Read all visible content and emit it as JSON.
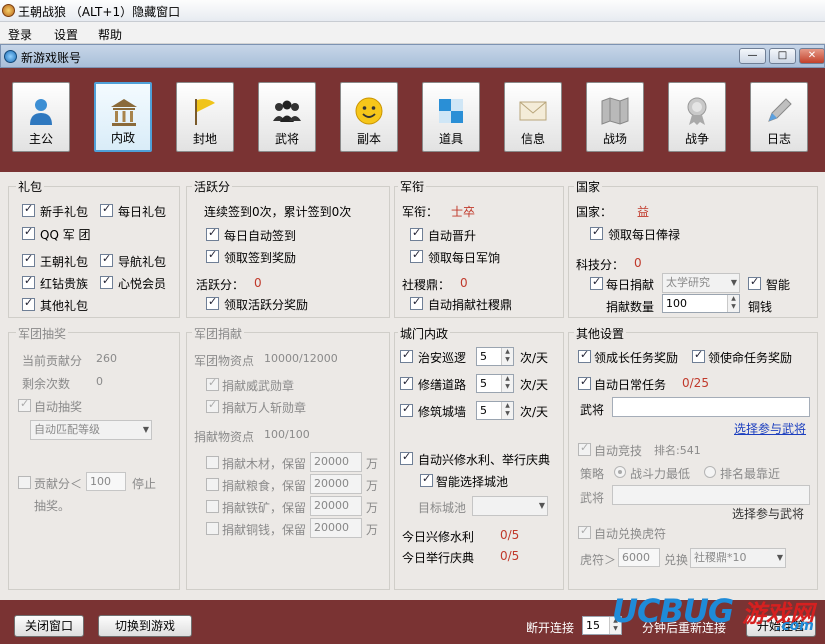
{
  "window": {
    "title": "王朝战狼 （ALT+1）隐藏窗口"
  },
  "menu": [
    "登录",
    "设置",
    "帮助"
  ],
  "subwindow": {
    "title": "新游戏账号",
    "buttons": [
      "—",
      "□",
      "✕"
    ]
  },
  "nav": [
    {
      "label": "主公",
      "icon": "person-icon"
    },
    {
      "label": "内政",
      "icon": "building-icon"
    },
    {
      "label": "封地",
      "icon": "flag-icon"
    },
    {
      "label": "武将",
      "icon": "group-icon"
    },
    {
      "label": "副本",
      "icon": "smiley-icon"
    },
    {
      "label": "道具",
      "icon": "tiles-icon"
    },
    {
      "label": "信息",
      "icon": "envelope-icon"
    },
    {
      "label": "战场",
      "icon": "map-icon"
    },
    {
      "label": "战争",
      "icon": "medal-icon"
    },
    {
      "label": "日志",
      "icon": "pencil-icon"
    }
  ],
  "libao": {
    "title": "礼包",
    "items": [
      "新手礼包",
      "每日礼包",
      "QQ 军 团",
      "王朝礼包",
      "导航礼包",
      "红钻贵族",
      "心悦会员",
      "其他礼包"
    ]
  },
  "huoyue": {
    "title": "活跃分",
    "sign_text": "连续签到0次，累计签到0次",
    "auto_sign": "每日自动签到",
    "sign_reward": "领取签到奖励",
    "score_label": "活跃分：",
    "score_value": "0",
    "score_reward": "领取活跃分奖励"
  },
  "junxian": {
    "title": "军衔",
    "rank_label": "军衔：",
    "rank_value": "士卒",
    "auto_promote": "自动晋升",
    "daily_pay": "领取每日军饷",
    "sheji_label": "社稷鼎：",
    "sheji_value": "0",
    "auto_donate": "自动捐献社稷鼎"
  },
  "guojia": {
    "title": "国家",
    "country_label": "国家：",
    "country_value": "益",
    "daily_salary": "领取每日俸禄",
    "tech_label": "科技分：",
    "tech_value": "0",
    "daily_donate": "每日捐献",
    "research": "太学研究",
    "smart": "智能",
    "qty_label": "捐献数量",
    "qty_value": "100",
    "unit": "铜钱"
  },
  "juntuan_choujiang": {
    "title": "军团抽奖",
    "contrib_label": "当前贡献分",
    "contrib_value": "260",
    "remain_label": "剩余次数",
    "remain_value": "0",
    "auto_draw": "自动抽奖",
    "level": "自动匹配等级",
    "contrib_prefix": "贡献分＜",
    "contrib_threshold": "100",
    "stop_text": "停止",
    "stop_text2": "抽奖。"
  },
  "juntuan_juanxian": {
    "title": "军团捐献",
    "goods_label": "军团物资点",
    "goods_value": "10000/12000",
    "medal1": "捐献威武勋章",
    "medal2": "捐献万人斩勋章",
    "goods2_label": "捐献物资点",
    "goods2_value": "100/100",
    "rows": [
      {
        "label": "捐献木材，保留",
        "value": "20000",
        "unit": "万"
      },
      {
        "label": "捐献粮食，保留",
        "value": "20000",
        "unit": "万"
      },
      {
        "label": "捐献铁矿，保留",
        "value": "20000",
        "unit": "万"
      },
      {
        "label": "捐献铜钱，保留",
        "value": "20000",
        "unit": "万"
      }
    ]
  },
  "chengmen": {
    "title": "城门内政",
    "rows": [
      {
        "label": "治安巡逻",
        "value": "5",
        "unit": "次/天"
      },
      {
        "label": "修缮道路",
        "value": "5",
        "unit": "次/天"
      },
      {
        "label": "修筑城墙",
        "value": "5",
        "unit": "次/天"
      }
    ],
    "auto_water": "自动兴修水利、举行庆典",
    "smart_city": "智能选择城池",
    "target_label": "目标城池",
    "today_water_label": "今日兴修水利",
    "today_water_value": "0/5",
    "today_fest_label": "今日举行庆典",
    "today_fest_value": "0/5"
  },
  "qita": {
    "title": "其他设置",
    "growth": "领成长任务奖励",
    "mission": "领使命任务奖励",
    "auto_daily": "自动日常任务",
    "daily_value": "0/25",
    "general_label": "武将",
    "choose_link": "选择参与武将",
    "auto_arena": "自动竞技",
    "rank_text": "排名:541",
    "strategy_label": "策略",
    "opt1": "战斗力最低",
    "opt2": "排名最靠近",
    "general2_label": "武将",
    "choose2": "选择参与武将",
    "auto_exchange": "自动兑换虎符",
    "tiger_prefix": "虎符＞",
    "tiger_value": "6000",
    "exchange_label": "兑换",
    "exchange_item": "社稷鼎*10"
  },
  "bottom": {
    "close_btn": "关闭窗口",
    "switch_btn": "切换到游戏",
    "disconnect_label": "断开连接",
    "minutes_value": "15",
    "reconnect_label": "分钟后重新连接",
    "start_btn": "开始挂管"
  },
  "watermark": {
    "brand": "UCBUG",
    "cn": "游戏网",
    "url": ".com"
  }
}
